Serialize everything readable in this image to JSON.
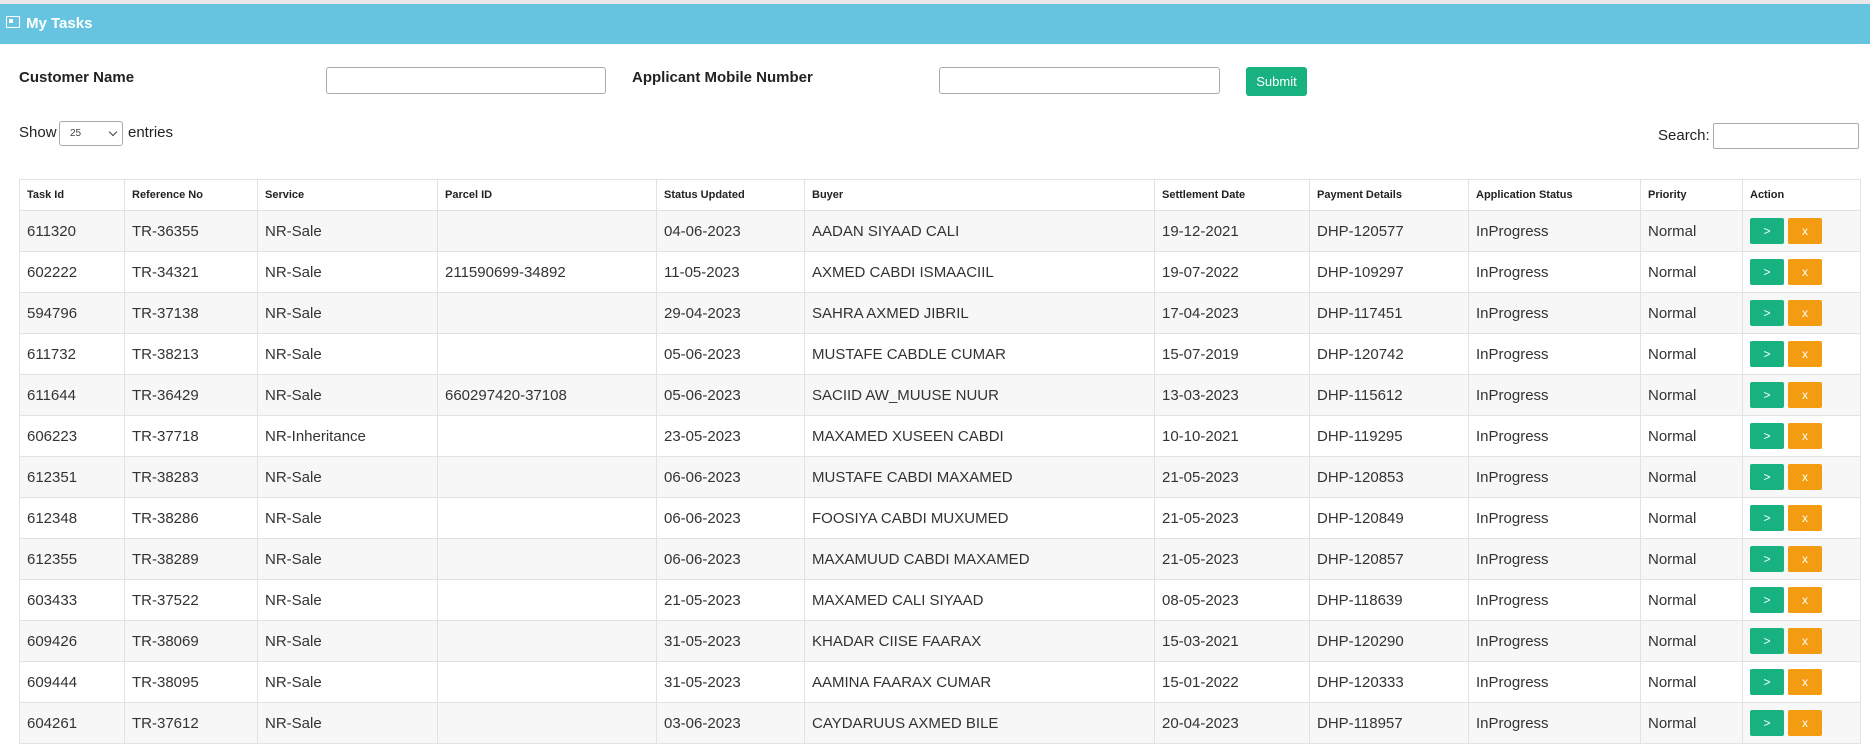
{
  "header": {
    "title": "My Tasks",
    "icon": "id-card-icon"
  },
  "filters": {
    "customer_name_label": "Customer Name",
    "mobile_label": "Applicant Mobile Number",
    "customer_name_value": "",
    "mobile_value": "",
    "submit_label": "Submit"
  },
  "length": {
    "show_label": "Show",
    "selected": "25",
    "entries_label": "entries"
  },
  "search": {
    "label": "Search:",
    "value": ""
  },
  "table": {
    "columns": [
      "Task Id",
      "Reference No",
      "Service",
      "Parcel ID",
      "Status Updated",
      "Buyer",
      "Settlement Date",
      "Payment Details",
      "Application Status",
      "Priority",
      "Action"
    ],
    "action_labels": {
      "open": ">",
      "close": "x"
    },
    "rows": [
      [
        "611320",
        "TR-36355",
        "NR-Sale",
        "",
        "04-06-2023",
        "AADAN SIYAAD CALI",
        "19-12-2021",
        "DHP-120577",
        "InProgress",
        "Normal"
      ],
      [
        "602222",
        "TR-34321",
        "NR-Sale",
        "211590699-34892",
        "11-05-2023",
        "AXMED CABDI ISMAACIIL",
        "19-07-2022",
        "DHP-109297",
        "InProgress",
        "Normal"
      ],
      [
        "594796",
        "TR-37138",
        "NR-Sale",
        "",
        "29-04-2023",
        "SAHRA AXMED JIBRIL",
        "17-04-2023",
        "DHP-117451",
        "InProgress",
        "Normal"
      ],
      [
        "611732",
        "TR-38213",
        "NR-Sale",
        "",
        "05-06-2023",
        "MUSTAFE CABDLE CUMAR",
        "15-07-2019",
        "DHP-120742",
        "InProgress",
        "Normal"
      ],
      [
        "611644",
        "TR-36429",
        "NR-Sale",
        "660297420-37108",
        "05-06-2023",
        "SACIID AW_MUUSE NUUR",
        "13-03-2023",
        "DHP-115612",
        "InProgress",
        "Normal"
      ],
      [
        "606223",
        "TR-37718",
        "NR-Inheritance",
        "",
        "23-05-2023",
        "MAXAMED XUSEEN CABDI",
        "10-10-2021",
        "DHP-119295",
        "InProgress",
        "Normal"
      ],
      [
        "612351",
        "TR-38283",
        "NR-Sale",
        "",
        "06-06-2023",
        "MUSTAFE CABDI MAXAMED",
        "21-05-2023",
        "DHP-120853",
        "InProgress",
        "Normal"
      ],
      [
        "612348",
        "TR-38286",
        "NR-Sale",
        "",
        "06-06-2023",
        "FOOSIYA CABDI MUXUMED",
        "21-05-2023",
        "DHP-120849",
        "InProgress",
        "Normal"
      ],
      [
        "612355",
        "TR-38289",
        "NR-Sale",
        "",
        "06-06-2023",
        "MAXAMUUD CABDI MAXAMED",
        "21-05-2023",
        "DHP-120857",
        "InProgress",
        "Normal"
      ],
      [
        "603433",
        "TR-37522",
        "NR-Sale",
        "",
        "21-05-2023",
        "MAXAMED CALI SIYAAD",
        "08-05-2023",
        "DHP-118639",
        "InProgress",
        "Normal"
      ],
      [
        "609426",
        "TR-38069",
        "NR-Sale",
        "",
        "31-05-2023",
        "KHADAR CIISE FAARAX",
        "15-03-2021",
        "DHP-120290",
        "InProgress",
        "Normal"
      ],
      [
        "609444",
        "TR-38095",
        "NR-Sale",
        "",
        "31-05-2023",
        "AAMINA FAARAX CUMAR",
        "15-01-2022",
        "DHP-120333",
        "InProgress",
        "Normal"
      ],
      [
        "604261",
        "TR-37612",
        "NR-Sale",
        "",
        "03-06-2023",
        "CAYDARUUS AXMED BILE",
        "20-04-2023",
        "DHP-118957",
        "InProgress",
        "Normal"
      ]
    ]
  },
  "colors": {
    "header": "#67c4e0",
    "submit": "#17b27f",
    "open_button": "#17b27f",
    "close_button": "#f39c12"
  }
}
